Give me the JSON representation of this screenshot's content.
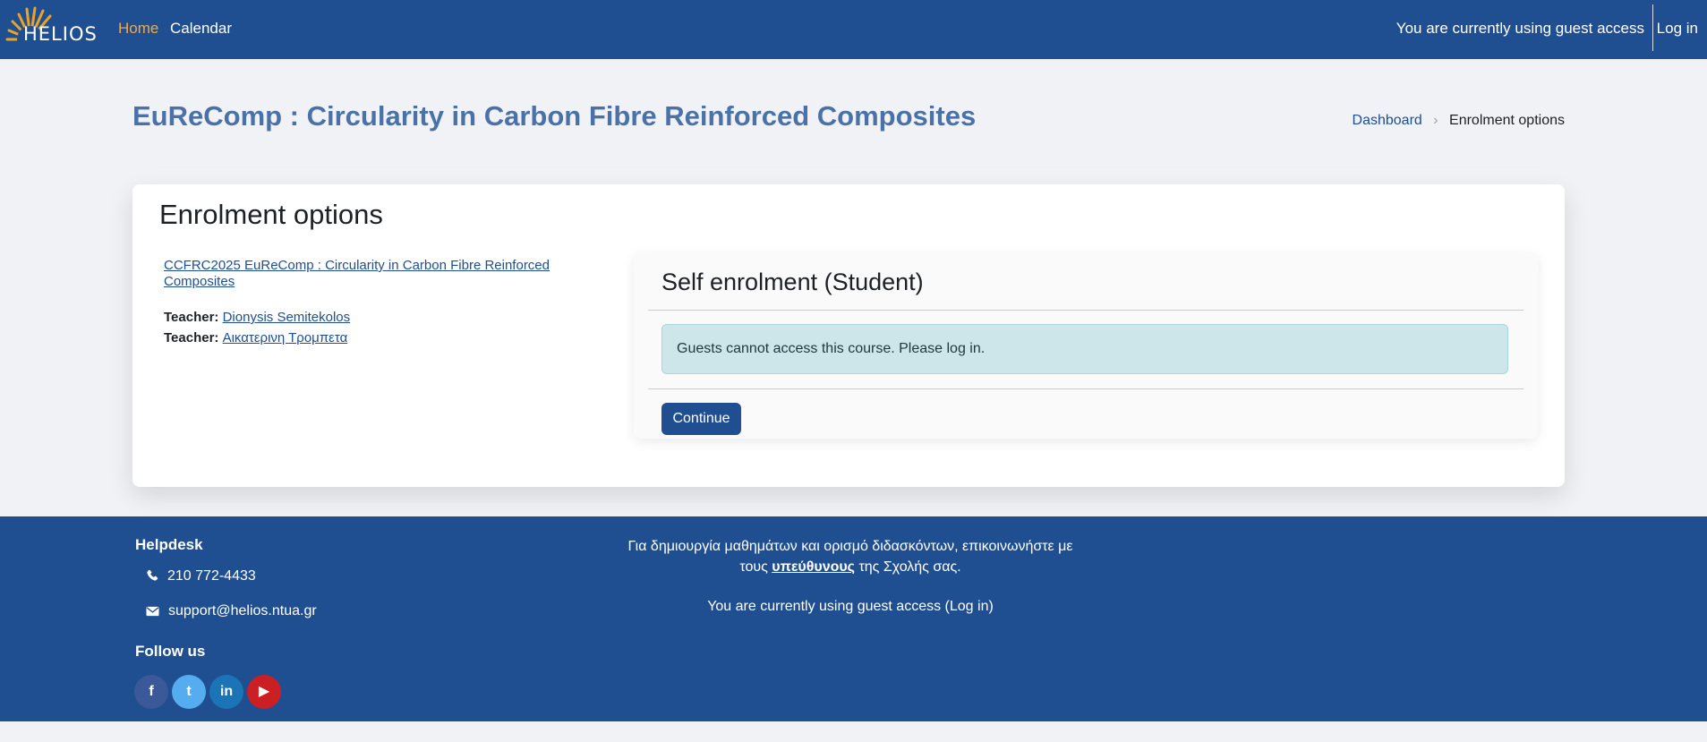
{
  "brand": {
    "logo_text": "HELIOS"
  },
  "nav": {
    "items": [
      {
        "label": "Home"
      },
      {
        "label": "Calendar"
      }
    ],
    "guest_notice": "You are currently using guest access",
    "login_label": "Log in"
  },
  "header": {
    "page_title": "EuReComp : Circularity in Carbon Fibre Reinforced Composites",
    "breadcrumb": [
      {
        "label": "Dashboard"
      },
      {
        "label": "Enrolment options"
      }
    ]
  },
  "main": {
    "heading": "Enrolment options",
    "course_link": "CCFRC2025 EuReComp : Circularity in Carbon Fibre Reinforced Composites",
    "teachers": [
      {
        "role": "Teacher:",
        "name": "Dionysis Semitekolos"
      },
      {
        "role": "Teacher:",
        "name": "Αικατερινη Τρομπετα"
      }
    ],
    "enrol": {
      "title": "Self enrolment (Student)",
      "alert": "Guests cannot access this course. Please log in.",
      "continue_label": "Continue"
    }
  },
  "footer": {
    "helpdesk_heading": "Helpdesk",
    "phone": "210 772-4433",
    "email": "support@helios.ntua.gr",
    "follow_heading": "Follow us",
    "socials": [
      {
        "icon": "facebook-icon",
        "glyph": "f"
      },
      {
        "icon": "twitter-icon",
        "glyph": "t"
      },
      {
        "icon": "linkedin-icon",
        "glyph": "in"
      },
      {
        "icon": "youtube-icon",
        "glyph": "▶"
      }
    ],
    "info_pre": "Για δημιουργία μαθημάτων και ορισμό διδασκόντων, επικοινωνήστε με τους",
    "info_link": "υπεύθυνους",
    "info_post": "της Σχολής σας.",
    "guest_text": "You are currently using guest access",
    "guest_login": "(Log in)"
  },
  "colors": {
    "primary": "#1f4f90",
    "accent": "#f0a948",
    "title": "#4a72a8",
    "alert_bg": "#cde6ea",
    "page_bg": "#f1f2f6"
  }
}
